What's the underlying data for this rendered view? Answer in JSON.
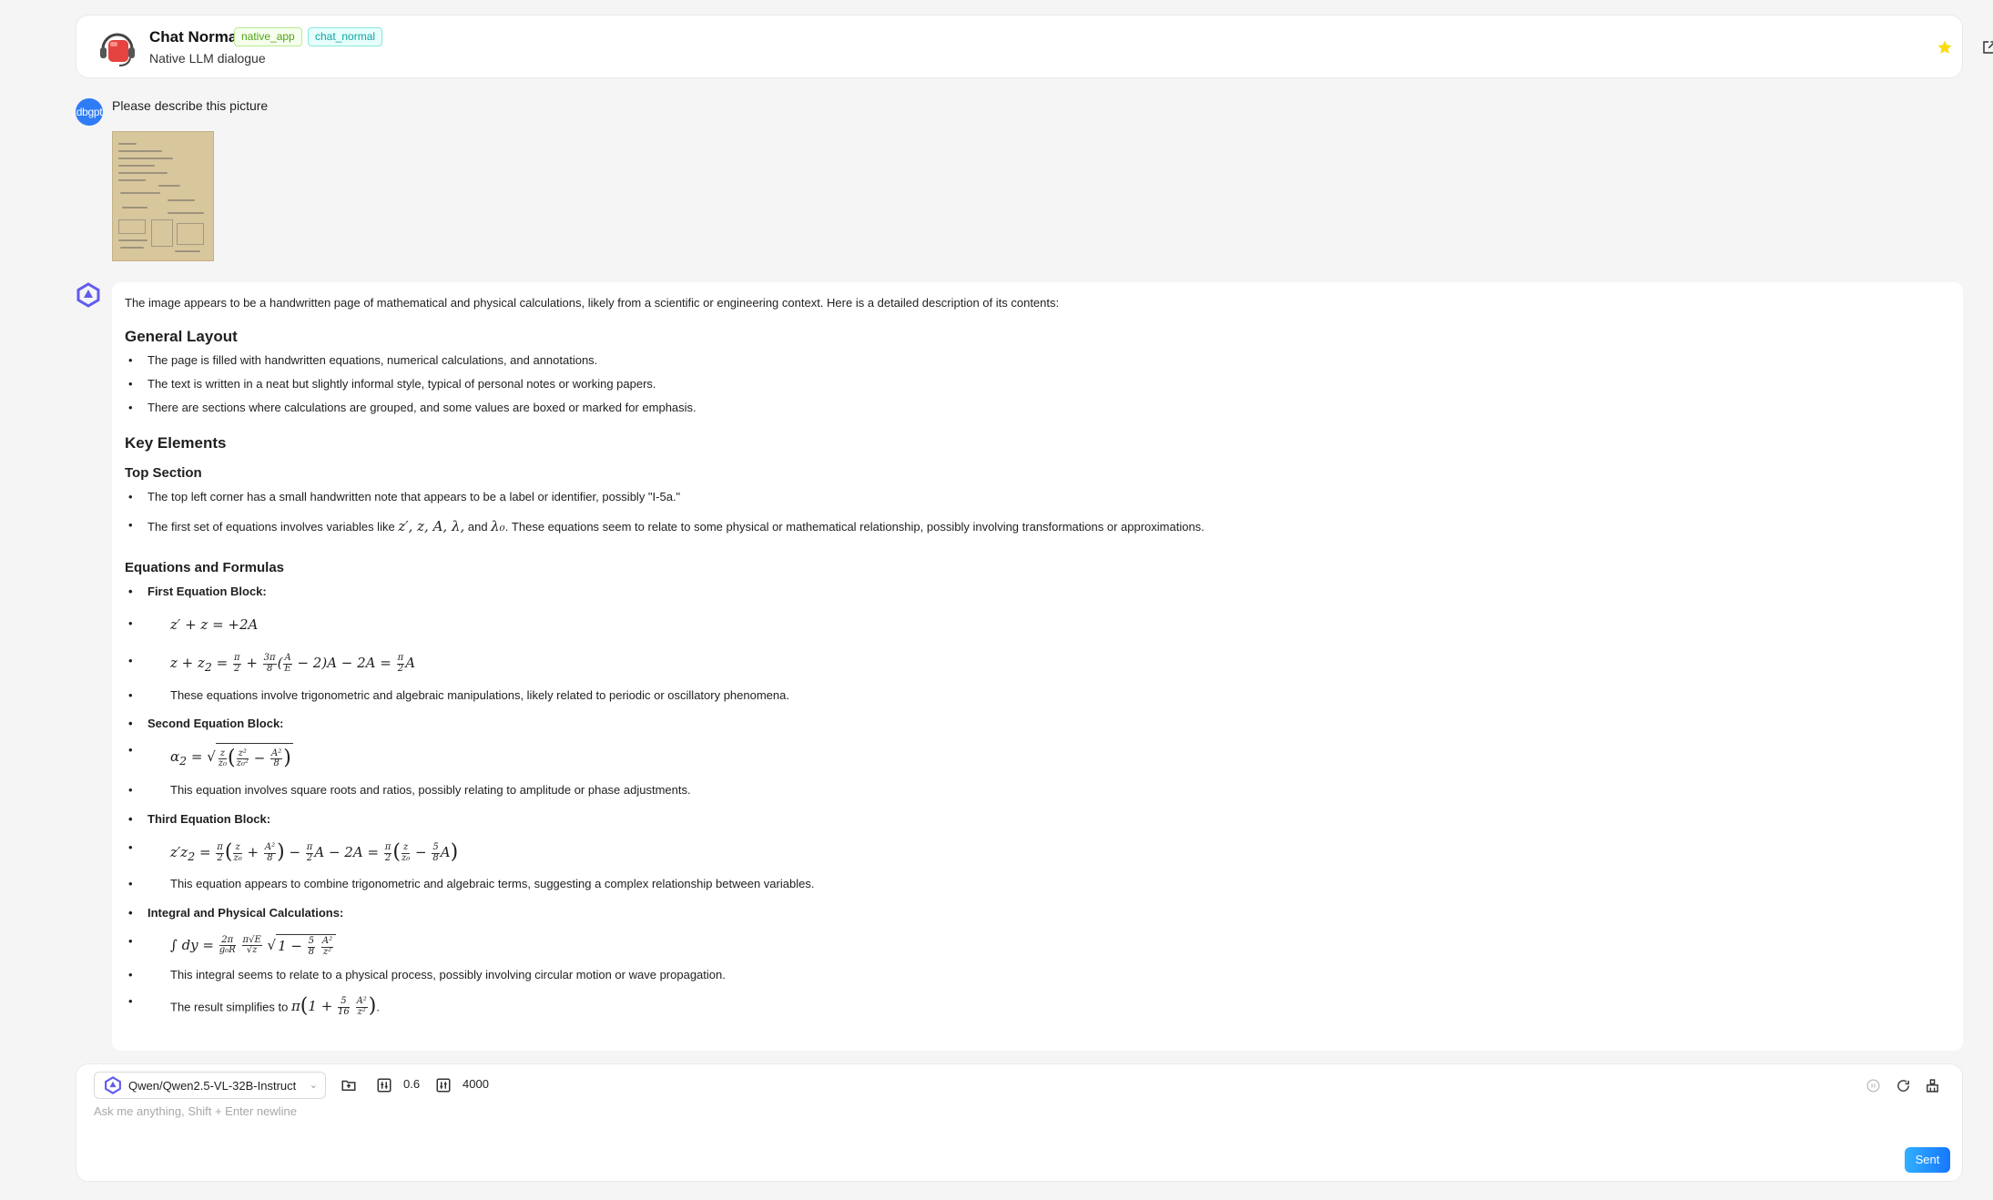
{
  "header": {
    "title": "Chat Normal",
    "tag_app": "native_app",
    "tag_scene": "chat_normal",
    "subtitle": "Native LLM dialogue",
    "favorite_color": "#fadb14"
  },
  "user_message": {
    "avatar_text": "dbgpt",
    "text": "Please describe this picture"
  },
  "answer": {
    "intro": "The image appears to be a handwritten page of mathematical and physical calculations, likely from a scientific or engineering context. Here is a detailed description of its contents:",
    "h_general": "General Layout",
    "general_items": [
      "The page is filled with handwritten equations, numerical calculations, and annotations.",
      "The text is written in a neat but slightly informal style, typical of personal notes or working papers.",
      "There are sections where calculations are grouped, and some values are boxed or marked for emphasis."
    ],
    "h_key": "Key Elements",
    "h_top": "Top Section",
    "top_item1": "The top left corner has a small handwritten note that appears to be a label or identifier, possibly \"I-5a.\"",
    "top_item2_pre": "The first set of equations involves variables like ",
    "top_item2_vars": "z′, z, A, λ,",
    "top_item2_and": " and ",
    "top_item2_lam": "λ₀",
    "top_item2_post": ". These equations seem to relate to some physical or mathematical relationship, possibly involving transformations or approximations.",
    "h_eq": "Equations and Formulas",
    "block1": "First Equation Block:",
    "b1_note": "These equations involve trigonometric and algebraic manipulations, likely related to periodic or oscillatory phenomena.",
    "block2": "Second Equation Block:",
    "b2_note": "This equation involves square roots and ratios, possibly relating to amplitude or phase adjustments.",
    "block3": "Third Equation Block:",
    "b3_note": "This equation appears to combine trigonometric and algebraic terms, suggesting a complex relationship between variables.",
    "block4": "Integral and Physical Calculations:",
    "b4_note": "This integral seems to relate to a physical process, possibly involving circular motion or wave propagation.",
    "b4_result_pre": "The result simplifies to "
  },
  "composer": {
    "model": "Qwen/Qwen2.5-VL-32B-Instruct",
    "temperature": "0.6",
    "max_tokens": "4000",
    "placeholder": "Ask me anything, Shift + Enter newline",
    "send_label": "Sent"
  }
}
